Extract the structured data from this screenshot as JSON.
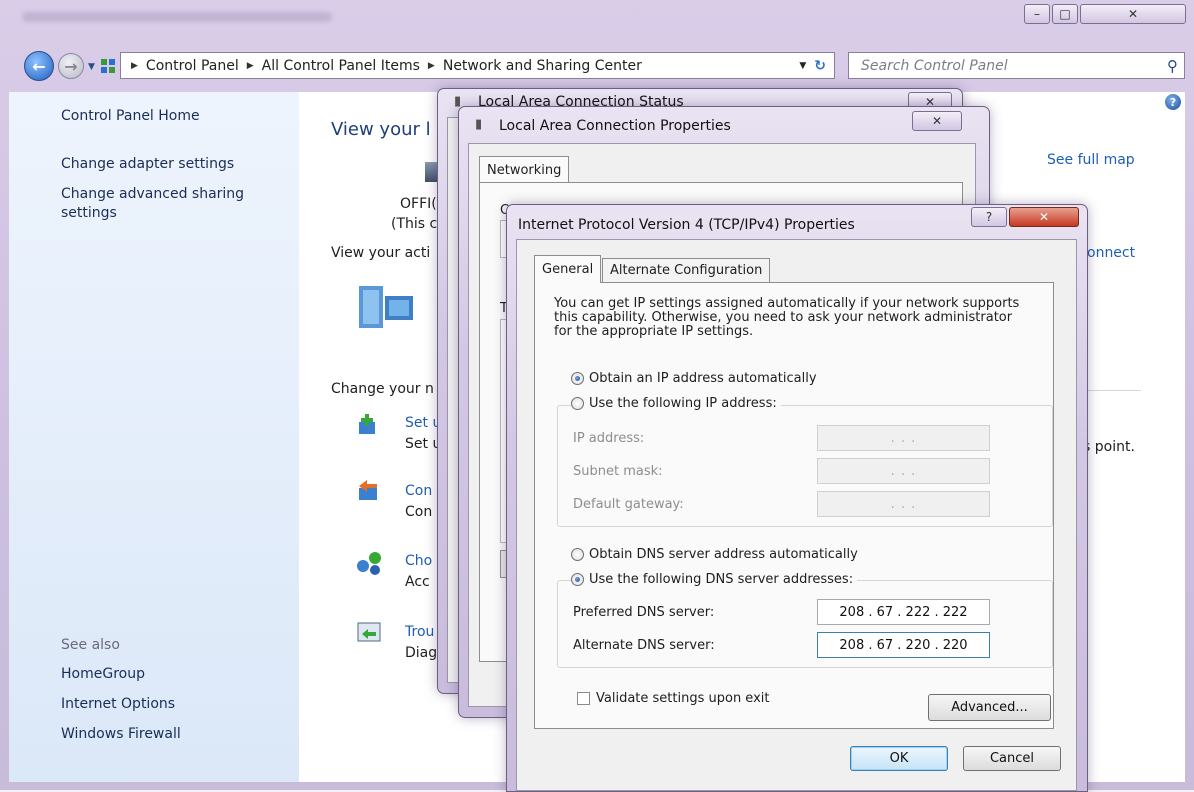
{
  "window": {
    "minimize": "–",
    "maximize": "□",
    "close": "✕"
  },
  "address": {
    "crumbs": [
      "Control Panel",
      "All Control Panel Items",
      "Network and Sharing Center"
    ],
    "search_placeholder": "Search Control Panel"
  },
  "sidebar": {
    "home": "Control Panel Home",
    "links": [
      "Change adapter settings",
      "Change advanced sharing",
      "settings"
    ],
    "see_also_label": "See also",
    "see_also": [
      "HomeGroup",
      "Internet Options",
      "Windows Firewall"
    ]
  },
  "content": {
    "heading": "View your l",
    "computer_name": "OFFI(",
    "computer_sub": "(This c",
    "active_networks": "View your acti",
    "change_settings": "Change your n",
    "see_full_map": "See full map",
    "connect": "onnect",
    "point_text": "s point.",
    "tasks": [
      {
        "title": "Set u",
        "desc": "Set u"
      },
      {
        "title": "Con",
        "desc": "Con"
      },
      {
        "title": "Cho",
        "desc": "Acc"
      },
      {
        "title": "Trou",
        "desc": "Diag"
      }
    ]
  },
  "status_dialog": {
    "title": "Local Area Connection Status",
    "close": "✕"
  },
  "props_dialog": {
    "title": "Local Area Connection Properties",
    "close": "✕",
    "tab": "Networking",
    "partial_c": "C",
    "partial_t": "T"
  },
  "ipv4_dialog": {
    "title": "Internet Protocol Version 4 (TCP/IPv4) Properties",
    "help": "?",
    "close": "✕",
    "tabs": [
      "General",
      "Alternate Configuration"
    ],
    "info": [
      "You can get IP settings assigned automatically if your network supports",
      "this capability. Otherwise, you need to ask your network administrator",
      "for the appropriate IP settings."
    ],
    "obtain_ip_auto": "Obtain an IP address automatically",
    "use_ip": "Use the following IP address:",
    "ip_label": "IP address:",
    "subnet_label": "Subnet mask:",
    "gateway_label": "Default gateway:",
    "empty_ip": ".   .   .",
    "obtain_dns_auto": "Obtain DNS server address automatically",
    "use_dns": "Use the following DNS server addresses:",
    "preferred_label": "Preferred DNS server:",
    "preferred_value": "208 . 67 . 222 . 222",
    "alternate_label": "Alternate DNS server:",
    "alternate_value": "208 . 67 . 220 . 220",
    "validate": "Validate settings upon exit",
    "advanced": "Advanced...",
    "ok": "OK",
    "cancel": "Cancel"
  }
}
